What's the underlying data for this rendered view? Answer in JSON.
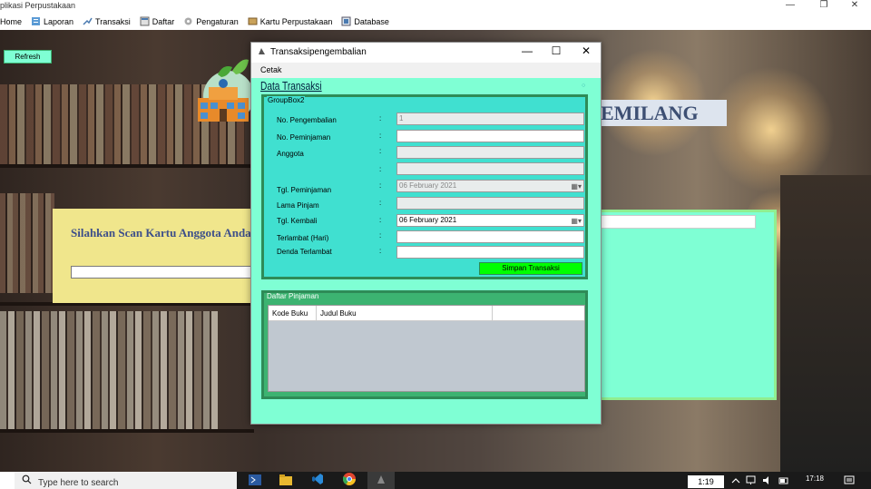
{
  "app": {
    "title": "plikasi Perpustakaan",
    "min_label": "—",
    "restore_label": "❐",
    "close_label": "✕"
  },
  "menu": {
    "items": [
      {
        "label": "Home",
        "icon": ""
      },
      {
        "label": "Laporan",
        "icon": "report-icon"
      },
      {
        "label": "Transaksi",
        "icon": "transaction-icon"
      },
      {
        "label": "Daftar",
        "icon": "list-icon"
      },
      {
        "label": "Pengaturan",
        "icon": "settings-icon"
      },
      {
        "label": "Kartu Perpustakaan",
        "icon": "card-icon"
      },
      {
        "label": "Database",
        "icon": "database-icon"
      }
    ]
  },
  "main": {
    "refresh_label": "Refresh",
    "brand_text": "EMILANG",
    "scan_label": "Silahkan Scan Kartu Anggota Anda",
    "scan_value": ""
  },
  "dialog": {
    "title": "Transaksipengembalian",
    "min_label": "—",
    "max_label": "☐",
    "close_label": "✕",
    "menu_cetak": "Cetak",
    "header": "Data Transaksi",
    "groupbox_title": "GroupBox2",
    "colon": ":",
    "fields": [
      {
        "label": "No. Pengembalian",
        "value": "1"
      },
      {
        "label": "No. Peminjaman",
        "value": ""
      },
      {
        "label": "Anggota",
        "value": ""
      },
      {
        "label": "",
        "value": ""
      },
      {
        "label": "Tgl. Peminjaman",
        "value": "06  February  2021"
      },
      {
        "label": "Lama Pinjam",
        "value": ""
      },
      {
        "label": "Tgl. Kembali",
        "value": "06  February  2021"
      },
      {
        "label": "Terlambat (Hari)",
        "value": ""
      },
      {
        "label": "Denda Terlambat",
        "value": ""
      }
    ],
    "save_label": "Simpan Transaksi",
    "daftar_title": "Daftar Pinjaman",
    "columns": [
      "Kode Buku",
      "Judul Buku",
      ""
    ]
  },
  "taskbar": {
    "search_placeholder": "Type here to search",
    "time": "17:18",
    "date_partial": "1:19"
  }
}
